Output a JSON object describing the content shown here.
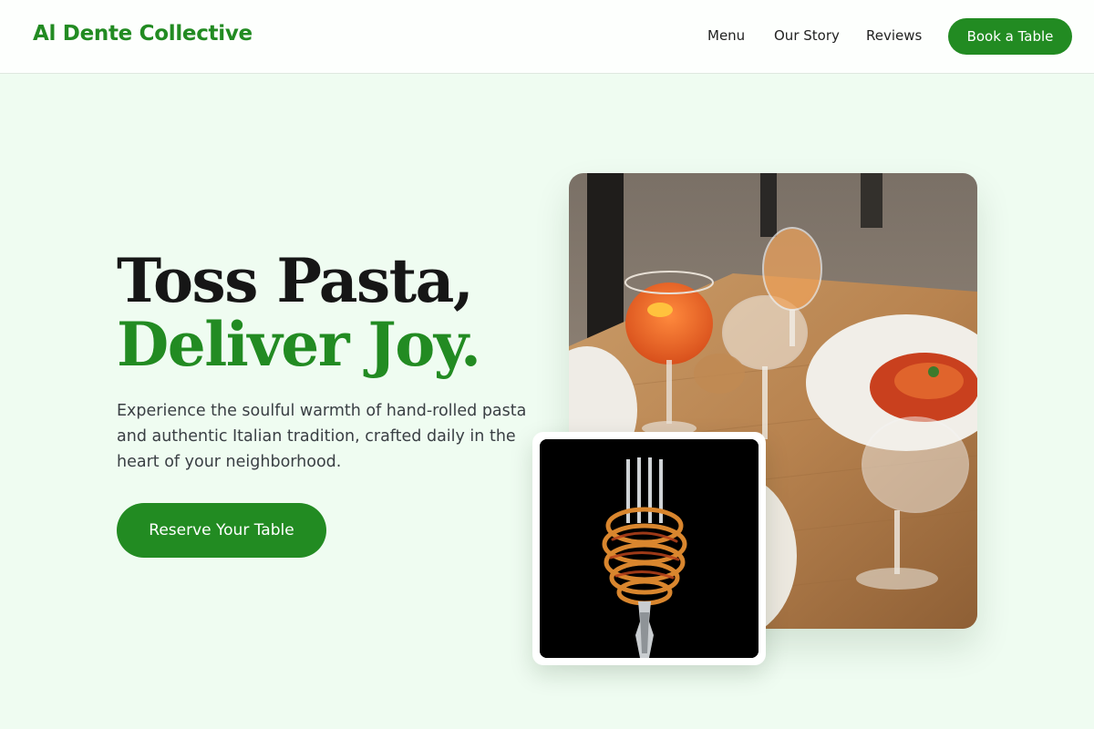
{
  "header": {
    "brand": "Al Dente Collective",
    "nav": [
      {
        "label": "Menu"
      },
      {
        "label": "Our Story"
      },
      {
        "label": "Reviews"
      }
    ],
    "cta_label": "Book a Table"
  },
  "hero": {
    "title_line1": "Toss Pasta,",
    "title_line2": "Deliver Joy.",
    "description": "Experience the soulful warmth of hand-rolled pasta and authentic Italian tradition, crafted daily in the heart of your neighborhood.",
    "cta_label": "Reserve Your Table"
  },
  "images": {
    "main": "photo of an outdoor table with aperitif glasses, wine glasses and a plate of pasta",
    "inset": "photo of spaghetti twirled on a fork against a black background"
  },
  "colors": {
    "accent": "#228b22",
    "background": "#effcf1",
    "header_bg": "#fdfffd",
    "heading": "#161616",
    "body_text": "#3a3f44"
  }
}
